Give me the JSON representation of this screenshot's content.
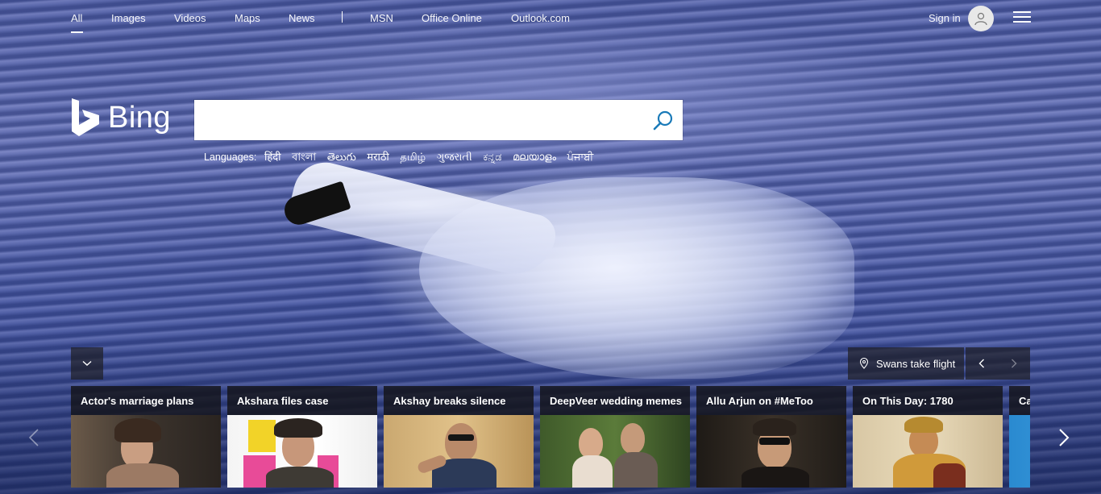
{
  "nav": {
    "items": [
      "All",
      "Images",
      "Videos",
      "Maps",
      "News",
      "MSN",
      "Office Online",
      "Outlook.com"
    ],
    "active": "All",
    "signin_label": "Sign in"
  },
  "logo": {
    "text": "Bing"
  },
  "search": {
    "value": "",
    "placeholder": ""
  },
  "languages": {
    "label": "Languages:",
    "items": [
      "हिंदी",
      "বাংলা",
      "తెలుగు",
      "मराठी",
      "தமிழ்",
      "ગુજરાતી",
      "ಕನ್ನಡ",
      "മലയാളം",
      "ਪੰਜਾਬੀ"
    ]
  },
  "image_info": {
    "title": "Swans take flight"
  },
  "cards": [
    {
      "title": "Actor's marriage plans"
    },
    {
      "title": "Akshara files case"
    },
    {
      "title": "Akshay breaks silence"
    },
    {
      "title": "DeepVeer wedding memes"
    },
    {
      "title": "Allu Arjun on #MeToo"
    },
    {
      "title": "On This Day: 1780"
    },
    {
      "title": "Ca"
    }
  ],
  "colors": {
    "search_icon": "#1a7ab8",
    "card_title_bg": "#1a1a1f"
  }
}
